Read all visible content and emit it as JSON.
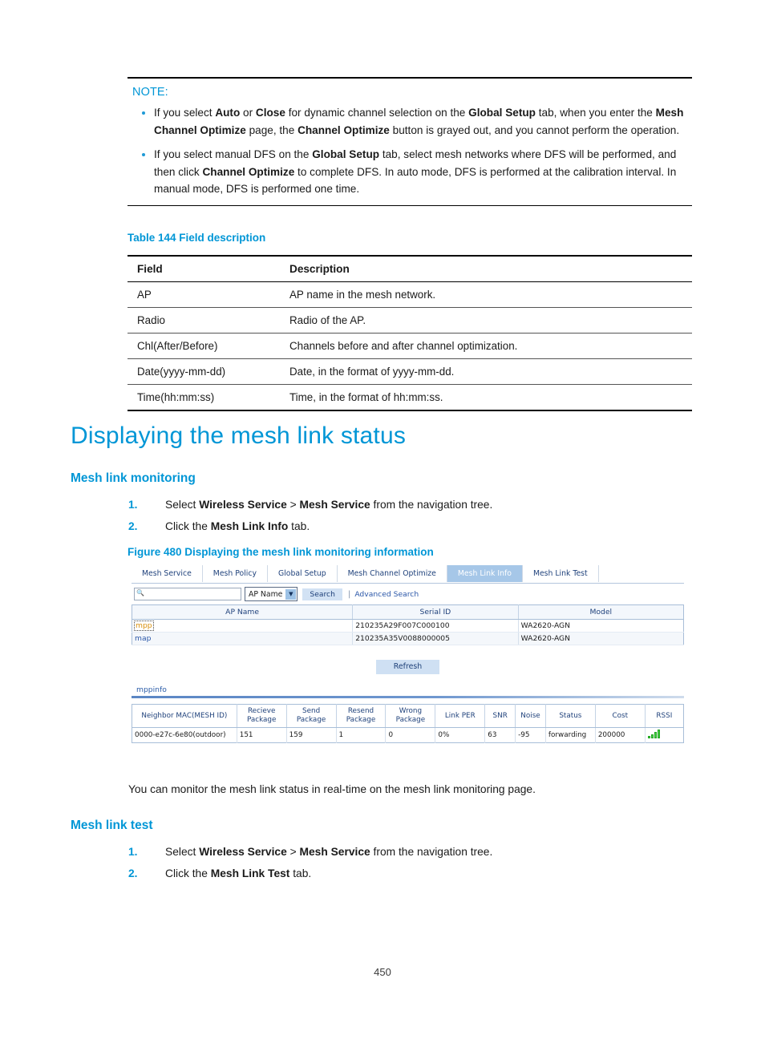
{
  "note": {
    "title": "NOTE:",
    "items": [
      [
        {
          "t": "If you select ",
          "b": false
        },
        {
          "t": "Auto",
          "b": true
        },
        {
          "t": " or ",
          "b": false
        },
        {
          "t": "Close",
          "b": true
        },
        {
          "t": " for dynamic channel selection on the ",
          "b": false
        },
        {
          "t": "Global Setup",
          "b": true
        },
        {
          "t": " tab, when you enter the ",
          "b": false
        },
        {
          "t": "Mesh Channel Optimize",
          "b": true
        },
        {
          "t": " page, the ",
          "b": false
        },
        {
          "t": "Channel Optimize",
          "b": true
        },
        {
          "t": " button is grayed out, and you cannot perform the operation.",
          "b": false
        }
      ],
      [
        {
          "t": "If you select manual DFS on the ",
          "b": false
        },
        {
          "t": "Global Setup",
          "b": true
        },
        {
          "t": " tab, select mesh networks where DFS will be performed, and then click ",
          "b": false
        },
        {
          "t": "Channel Optimize",
          "b": true
        },
        {
          "t": " to complete DFS. In auto mode, DFS is performed at the calibration interval. In manual mode, DFS is performed one time.",
          "b": false
        }
      ]
    ]
  },
  "field_table": {
    "caption": "Table 144 Field description",
    "headers": [
      "Field",
      "Description"
    ],
    "rows": [
      [
        "AP",
        "AP name in the mesh network."
      ],
      [
        "Radio",
        "Radio of the AP."
      ],
      [
        "Chl(After/Before)",
        "Channels before and after channel optimization."
      ],
      [
        "Date(yyyy-mm-dd)",
        "Date, in the format of yyyy-mm-dd."
      ],
      [
        "Time(hh:mm:ss)",
        "Time, in the format of hh:mm:ss."
      ]
    ]
  },
  "headings": {
    "h1": "Displaying the mesh link status",
    "mesh_link_monitoring": "Mesh link monitoring",
    "mesh_link_test": "Mesh link test"
  },
  "steps_monitoring": [
    {
      "num": "1.",
      "parts": [
        {
          "t": "Select ",
          "b": false
        },
        {
          "t": "Wireless Service",
          "b": true
        },
        {
          "t": " > ",
          "b": false
        },
        {
          "t": "Mesh Service",
          "b": true
        },
        {
          "t": " from the navigation tree.",
          "b": false
        }
      ]
    },
    {
      "num": "2.",
      "parts": [
        {
          "t": "Click the ",
          "b": false
        },
        {
          "t": "Mesh Link Info",
          "b": true
        },
        {
          "t": " tab.",
          "b": false
        }
      ]
    }
  ],
  "steps_test": [
    {
      "num": "1.",
      "parts": [
        {
          "t": "Select ",
          "b": false
        },
        {
          "t": "Wireless Service",
          "b": true
        },
        {
          "t": " > ",
          "b": false
        },
        {
          "t": "Mesh Service",
          "b": true
        },
        {
          "t": " from the navigation tree.",
          "b": false
        }
      ]
    },
    {
      "num": "2.",
      "parts": [
        {
          "t": "Click the ",
          "b": false
        },
        {
          "t": "Mesh Link Test",
          "b": true
        },
        {
          "t": " tab.",
          "b": false
        }
      ]
    }
  ],
  "figure": {
    "caption": "Figure 480 Displaying the mesh link monitoring information",
    "tabs": [
      {
        "label": "Mesh Service",
        "active": false
      },
      {
        "label": "Mesh Policy",
        "active": false
      },
      {
        "label": "Global Setup",
        "active": false
      },
      {
        "label": "Mesh Channel Optimize",
        "active": false
      },
      {
        "label": "Mesh Link Info",
        "active": true
      },
      {
        "label": "Mesh Link Test",
        "active": false
      }
    ],
    "search": {
      "value": "",
      "placeholder": "",
      "icon": "search-icon",
      "select_value": "AP Name",
      "caret": "▼",
      "button_label": "Search",
      "separator": "|",
      "advanced_label": "Advanced Search"
    },
    "ap_table": {
      "headers": [
        "AP Name",
        "Serial ID",
        "Model"
      ],
      "rows": [
        {
          "ap_name": "mpp",
          "serial_id": "210235A29F007C000100",
          "model": "WA2620-AGN",
          "focused": true
        },
        {
          "ap_name": "map",
          "serial_id": "210235A35V0088000005",
          "model": "WA2620-AGN",
          "focused": false
        }
      ]
    },
    "refresh_label": "Refresh",
    "mppinfo_label": "mppinfo",
    "detail_table": {
      "headers": [
        "Neighbor MAC(MESH ID)",
        "Recieve Package",
        "Send Package",
        "Resend Package",
        "Wrong Package",
        "Link PER",
        "SNR",
        "Noise",
        "Status",
        "Cost",
        "RSSI"
      ],
      "rows": [
        {
          "neighbor_mac": "0000-e27c-6e80(outdoor)",
          "recieve_package": "151",
          "send_package": "159",
          "resend_package": "1",
          "wrong_package": "0",
          "link_per": "0%",
          "snr": "63",
          "noise": "-95",
          "status": "forwarding",
          "cost": "200000",
          "rssi_bars": 4
        }
      ]
    }
  },
  "body_paragraph": "You can monitor the mesh link status in real-time on the mesh link monitoring page.",
  "page_number": "450",
  "colors": {
    "accent": "#0096d6",
    "link": "#2b57a8",
    "tab_active_bg": "#a6c7e8",
    "signal_green": "#46d246",
    "focus_orange": "#d9900d"
  }
}
